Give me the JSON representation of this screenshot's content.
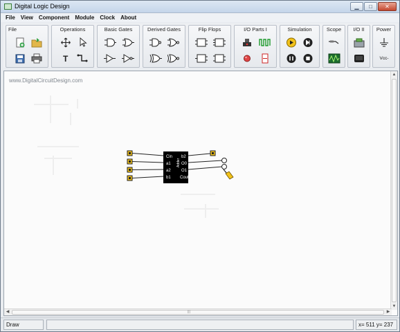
{
  "window": {
    "title": "Digital Logic Design",
    "controls": [
      "minimize",
      "maximize",
      "close"
    ]
  },
  "menu": [
    {
      "label": "File"
    },
    {
      "label": "View"
    },
    {
      "label": "Component"
    },
    {
      "label": "Module"
    },
    {
      "label": "Clock"
    },
    {
      "label": "About"
    }
  ],
  "toolbar": {
    "groups": [
      {
        "title": "File",
        "tools": [
          "new-document",
          "open-folder",
          "save-disk",
          "print"
        ]
      },
      {
        "title": "Operations",
        "tools": [
          "move",
          "select-pointer",
          "text",
          "wire"
        ]
      },
      {
        "title": "Basic Gates",
        "tools": [
          "and-gate",
          "or-gate",
          "buffer-gate",
          "not-gate"
        ]
      },
      {
        "title": "Derived Gates",
        "tools": [
          "nand-gate",
          "nor-gate",
          "xor-gate",
          "xnor-gate"
        ]
      },
      {
        "title": "Flip Flops",
        "tools": [
          "d-flip-flop",
          "jk-flip-flop",
          "t-flip-flop",
          "sr-flip-flop"
        ]
      },
      {
        "title": "I/O Parts I",
        "tools": [
          "push-button",
          "clock-wave",
          "led-red",
          "seven-segment"
        ]
      },
      {
        "title": "Simulation",
        "tools": [
          "play",
          "step-forward",
          "pause",
          "stop"
        ]
      },
      {
        "title": "Scope",
        "tools": [
          "probe",
          "scope-wave"
        ]
      },
      {
        "title": "I/O II",
        "tools": [
          "device",
          "display"
        ]
      },
      {
        "title": "Power",
        "tools": [
          "ground",
          "vcc"
        ],
        "vcc_label": "Vcc-"
      }
    ]
  },
  "canvas": {
    "watermark": "www.DigitalCircuitDesign.com",
    "chip": {
      "left_pins": [
        "Cin",
        "a1",
        "a2",
        "b1"
      ],
      "right_pins": [
        "b2",
        "O0",
        "O1",
        "Cout"
      ],
      "center_label": "Adder"
    }
  },
  "status": {
    "mode": "Draw",
    "coords": "x= 511  y= 237"
  },
  "colors": {
    "accent": "#f2c21a",
    "chip": "#000000",
    "sim_play": "#f2c21a"
  }
}
